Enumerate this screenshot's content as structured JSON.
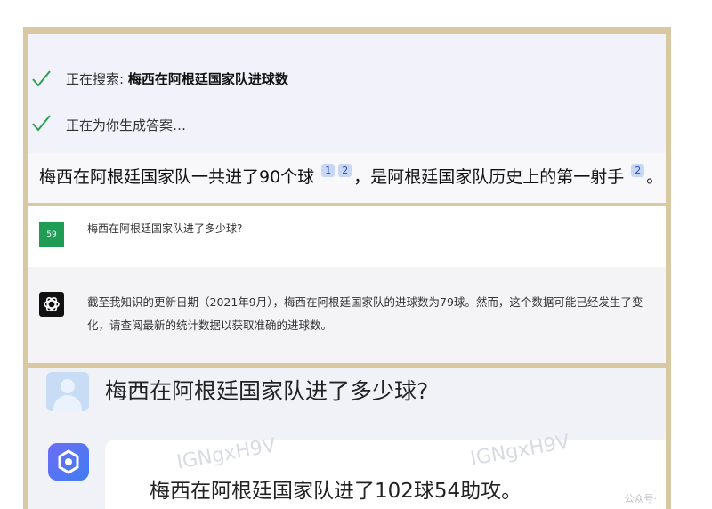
{
  "bing": {
    "status_search_prefix": "正在搜索: ",
    "status_search_query": "梅西在阿根廷国家队进球数",
    "status_generating": "正在为你生成答案…",
    "answer_part1": "梅西在阿根廷国家队一共进了90个球",
    "cite_1": "1",
    "cite_2": "2",
    "answer_part2": "，是阿根廷国家队历史上的第一射手",
    "cite_3": "2",
    "answer_end": "。"
  },
  "chatgpt": {
    "user_avatar": "59",
    "user_question": "梅西在阿根廷国家队进了多少球?",
    "assistant_reply": "截至我知识的更新日期（2021年9月），梅西在阿根廷国家队的进球数为79球。然而，这个数据可能已经发生了变化，请查阅最新的统计数据以获取准确的进球数。"
  },
  "baidu": {
    "question": "梅西在阿根廷国家队进了多少球?",
    "answer": "梅西在阿根廷国家队进了102球54助攻。",
    "watermark_1": "IGNgxH9V",
    "watermark_2": "IGNgxH9V",
    "ghost_text": "公众号·"
  },
  "colors": {
    "frame_border": "#d9c9a2",
    "check_green": "#2e9e4f",
    "cite_bg": "#c8d8f4",
    "user_avatar_bg": "#1f9d55"
  }
}
